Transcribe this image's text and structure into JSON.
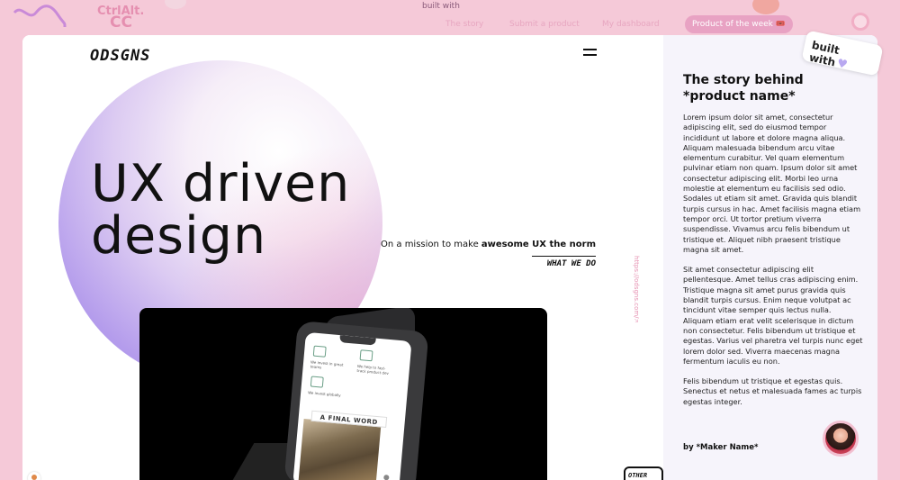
{
  "background": {
    "brand_line1": "CtrlAlt.",
    "brand_line2": "CC",
    "built_with": "built with",
    "nav": [
      "The story",
      "Submit a product",
      "My dashboard"
    ],
    "product_of_week": "Product of the week 🎟️"
  },
  "site": {
    "logo": "ODSGNS",
    "headline_line1": "UX driven",
    "headline_line2": "design",
    "mission_prefix": "On a mission to make ",
    "mission_bold": "awesome UX the norm",
    "what_we_do": "WHAT WE DO",
    "vertical_url": "https://odsgns.com/🡥",
    "other_button": "OTHER",
    "phone_banner": "A FINAL WORD",
    "phone_texts": [
      "We invest in great teams",
      "We help to fast-track product dev",
      "We invest globally"
    ]
  },
  "panel": {
    "title": "The story behind *product name*",
    "paragraphs": [
      "Lorem ipsum dolor sit amet, consectetur adipiscing elit, sed do eiusmod tempor incididunt ut labore et dolore magna aliqua. Aliquam malesuada bibendum arcu vitae elementum curabitur. Vel quam elementum pulvinar etiam non quam. Ipsum dolor sit amet consectetur adipiscing elit. Morbi leo urna molestie at elementum eu facilisis sed odio. Sodales ut etiam sit amet. Gravida quis blandit turpis cursus in hac. Amet facilisis magna etiam tempor orci. Ut tortor pretium viverra suspendisse. Vivamus arcu felis bibendum ut tristique et. Aliquet nibh praesent tristique magna sit amet.",
      "Sit amet consectetur adipiscing elit pellentesque. Amet tellus cras adipiscing enim. Tristique magna sit amet purus gravida quis blandit turpis cursus. Enim neque volutpat ac tincidunt vitae semper quis lectus nulla. Aliquam etiam erat velit scelerisque in dictum non consectetur. Felis bibendum ut tristique et egestas. Varius vel pharetra vel turpis nunc eget lorem dolor sed. Viverra maecenas magna fermentum iaculis eu non.",
      "Felis bibendum ut tristique et egestas quis. Senectus et netus et malesuada fames ac turpis egestas integer."
    ],
    "maker": "by *Maker Name*",
    "badge": "built with",
    "badge_icon": "heart-icon"
  },
  "colors": {
    "background": "#f5c9d8",
    "accent_pink": "#e58fb0",
    "accent_lavender": "#b8a8f0"
  }
}
